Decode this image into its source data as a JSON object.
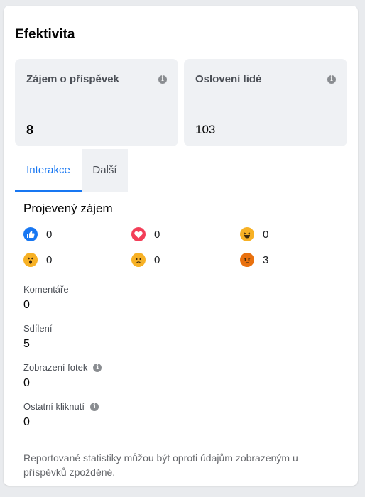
{
  "title": "Efektivita",
  "metrics": [
    {
      "label": "Zájem o příspěvek",
      "value": "8"
    },
    {
      "label": "Oslovení lidé",
      "value": "103"
    }
  ],
  "tabs": [
    {
      "label": "Interakce",
      "active": true
    },
    {
      "label": "Další",
      "active": false
    }
  ],
  "section_title": "Projevený zájem",
  "reactions": [
    {
      "name": "like-icon",
      "count": "0",
      "color": "#1877f2"
    },
    {
      "name": "love-icon",
      "count": "0",
      "color": "#f33e58"
    },
    {
      "name": "haha-icon",
      "count": "0",
      "color": "#f7b125"
    },
    {
      "name": "wow-icon",
      "count": "0",
      "color": "#f7b125"
    },
    {
      "name": "sad-icon",
      "count": "0",
      "color": "#f7b125"
    },
    {
      "name": "angry-icon",
      "count": "3",
      "color": "#e9710f"
    }
  ],
  "stats": [
    {
      "label": "Komentáře",
      "value": "0"
    },
    {
      "label": "Sdílení",
      "value": "5"
    },
    {
      "label": "Zobrazení fotek",
      "value": "0"
    },
    {
      "label": "Ostatní kliknutí",
      "value": "0"
    }
  ],
  "footnote": "Reportované statistiky můžou být oproti údajům zobrazeným u příspěvků zpožděné."
}
